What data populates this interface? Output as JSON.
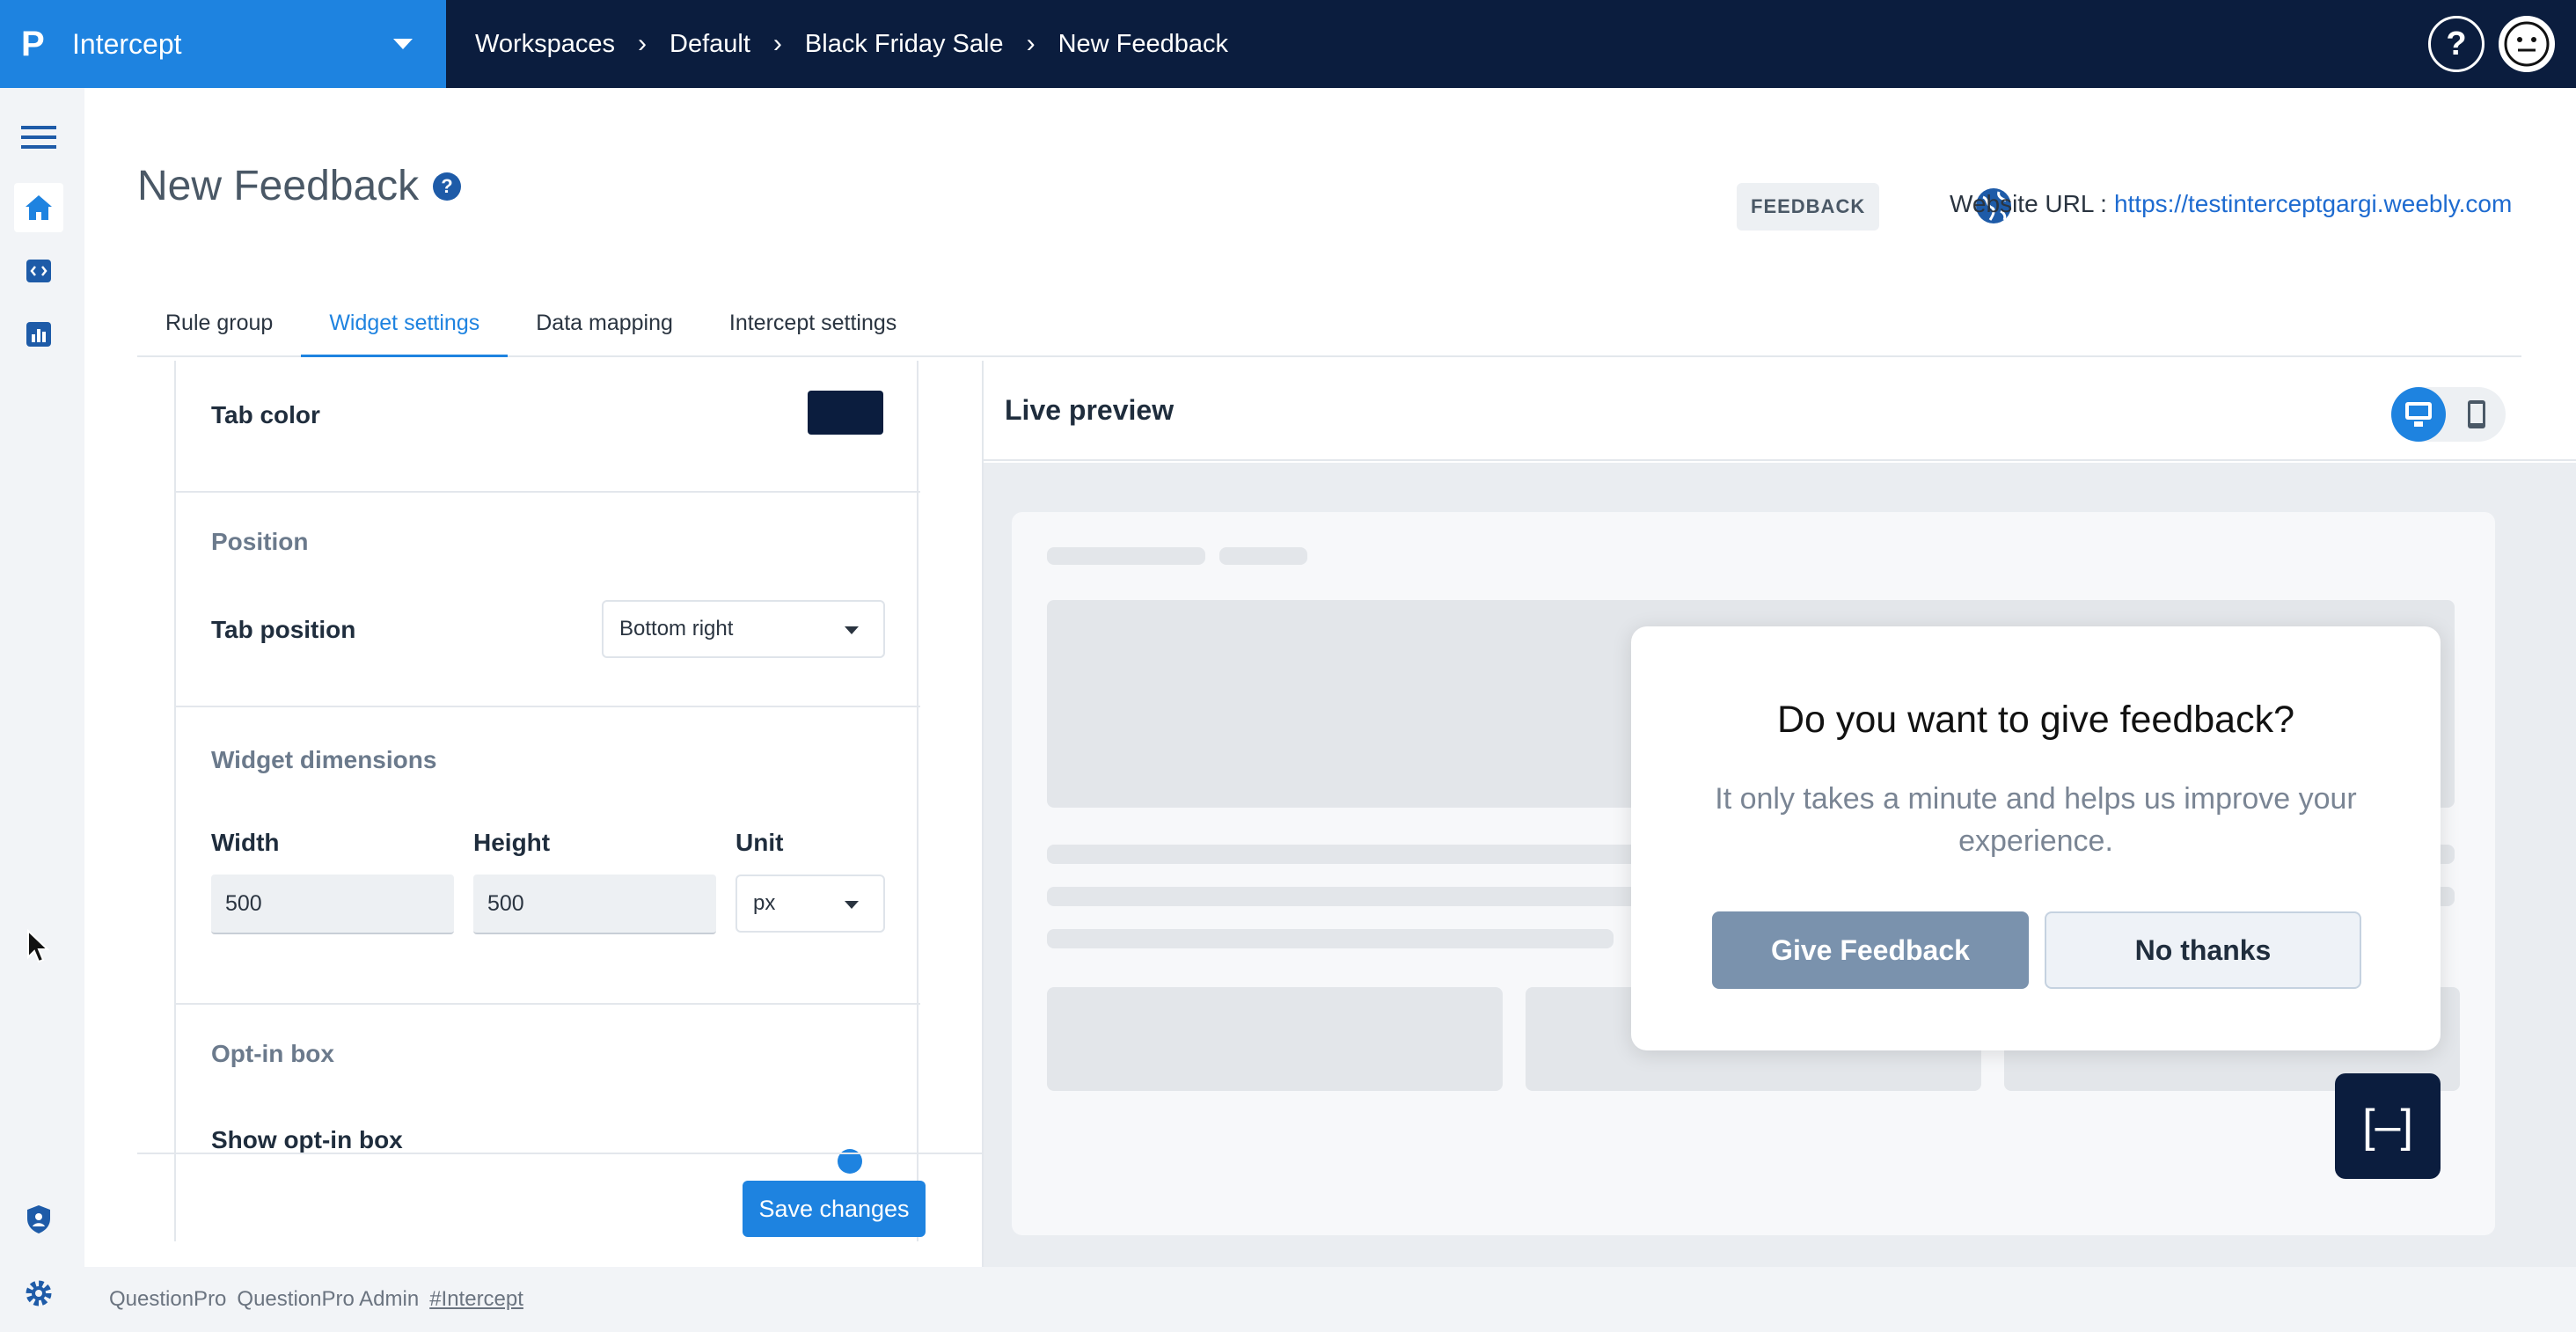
{
  "brand": {
    "logo": "P",
    "name": "Intercept"
  },
  "breadcrumbs": [
    "Workspaces",
    "Default",
    "Black Friday Sale",
    "New Feedback"
  ],
  "header": {
    "help_label": "?"
  },
  "page": {
    "title": "New Feedback",
    "title_help": "?",
    "type_badge": "FEEDBACK",
    "url_label": "Website URL :",
    "url_value": "https://testinterceptgargi.weebly.com"
  },
  "tabs": [
    {
      "label": "Rule group",
      "active": false
    },
    {
      "label": "Widget settings",
      "active": true
    },
    {
      "label": "Data mapping",
      "active": false
    },
    {
      "label": "Intercept settings",
      "active": false
    }
  ],
  "settings": {
    "tab_color": {
      "label": "Tab color",
      "value": "#0b1d3e"
    },
    "position": {
      "title": "Position",
      "tab_position_label": "Tab position",
      "tab_position_value": "Bottom right"
    },
    "dimensions": {
      "title": "Widget dimensions",
      "width_label": "Width",
      "width_value": "500",
      "height_label": "Height",
      "height_value": "500",
      "unit_label": "Unit",
      "unit_value": "px"
    },
    "optin": {
      "title": "Opt-in box",
      "show_label": "Show opt-in box"
    },
    "save_label": "Save changes"
  },
  "preview": {
    "title": "Live preview",
    "device_selected": "desktop",
    "dialog": {
      "question": "Do you want to give feedback?",
      "subtitle": "It only takes a minute and helps us improve your experience.",
      "primary": "Give Feedback",
      "secondary": "No thanks"
    },
    "tab_glyph": "[–]"
  },
  "footer": {
    "org": "QuestionPro",
    "user": "QuestionPro Admin",
    "tag": "#Intercept"
  },
  "colors": {
    "accent": "#1e83e0",
    "navy": "#0b1d3e",
    "dialog_primary": "#7a92ad"
  },
  "icons": [
    "hamburger-icon",
    "home-icon",
    "code-icon",
    "chart-icon",
    "shield-icon",
    "gear-icon",
    "globe-icon",
    "desktop-icon",
    "mobile-icon",
    "avatar-icon",
    "cursor-icon"
  ]
}
